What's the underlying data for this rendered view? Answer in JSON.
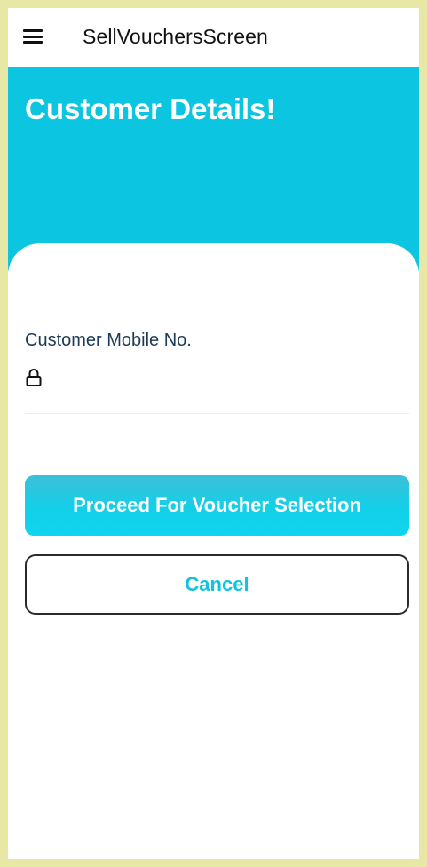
{
  "appbar": {
    "menu_icon": "hamburger-menu-icon",
    "title": "SellVouchersScreen"
  },
  "header": {
    "title": "Customer Details!",
    "background_color": "#0cc5e0"
  },
  "form": {
    "mobile_label": "Customer Mobile No.",
    "mobile_icon": "lock-icon",
    "mobile_value": ""
  },
  "actions": {
    "proceed_label": "Proceed For Voucher Selection",
    "cancel_label": "Cancel",
    "accent_color": "#10c4df"
  }
}
